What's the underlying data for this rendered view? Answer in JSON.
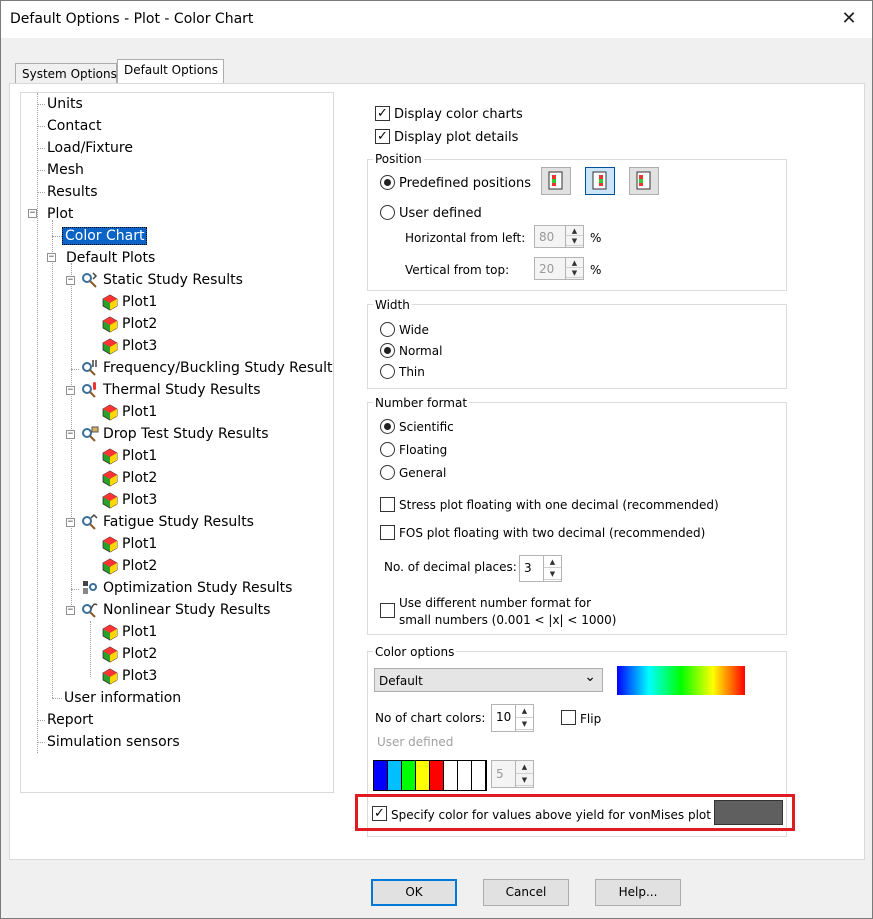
{
  "window": {
    "title": "Default Options - Plot - Color Chart",
    "close": "✕"
  },
  "tabs": [
    {
      "label": "System Options"
    },
    {
      "label": "Default Options"
    }
  ],
  "tree": {
    "units": "Units",
    "contact": "Contact",
    "load": "Load/Fixture",
    "mesh": "Mesh",
    "results": "Results",
    "plot": "Plot",
    "color_chart": "Color Chart",
    "default_plots": "Default Plots",
    "static": "Static Study Results",
    "freq": "Frequency/Buckling Study Results",
    "thermal": "Thermal Study Results",
    "drop": "Drop Test Study Results",
    "fatigue": "Fatigue Study Results",
    "optimization": "Optimization Study Results",
    "nonlinear": "Nonlinear Study Results",
    "plot1": "Plot1",
    "plot2": "Plot2",
    "plot3": "Plot3",
    "user_info": "User information",
    "report": "Report",
    "sensors": "Simulation sensors",
    "expand_sign": "+",
    "collapse_sign": "−"
  },
  "display": {
    "color_charts": "Display color charts",
    "plot_details": "Display plot details",
    "check": "✓"
  },
  "position": {
    "title": "Position",
    "predefined": "Predefined positions",
    "user_defined": "User defined",
    "horizontal_label": "Horizontal from left:",
    "horizontal_value": "80",
    "vertical_label": "Vertical from top:",
    "vertical_value": "20",
    "percent": "%"
  },
  "width": {
    "title": "Width",
    "wide": "Wide",
    "normal": "Normal",
    "thin": "Thin"
  },
  "number_format": {
    "title": "Number format",
    "scientific": "Scientific",
    "floating": "Floating",
    "general": "General",
    "stress_floating": "Stress plot floating with one decimal (recommended)",
    "fos_floating": "FOS plot floating with two decimal (recommended)",
    "decimal_label": "No. of decimal places:",
    "decimal_value": "3",
    "small_numbers_line1": "Use different number format for",
    "small_numbers_line2": "small numbers (0.001 < |x| < 1000)"
  },
  "color_options": {
    "title": "Color options",
    "scheme": "Default",
    "chart_colors_label": "No of chart colors:",
    "chart_colors_value": "10",
    "flip": "Flip",
    "user_defined": "User defined",
    "swatch_count": "5",
    "yield_label": "Specify color for values above yield for vonMises plot",
    "yield_color": "#5f5f5f",
    "swatches": [
      "#0000ff",
      "#00bfff",
      "#00ff00",
      "#ffff00",
      "#ff0000",
      "#ffffff",
      "#ffffff",
      "#ffffff"
    ]
  },
  "spin_arrows": {
    "up": "▲",
    "down": "▼",
    "dropdown": "⌄"
  },
  "buttons": {
    "ok": "OK",
    "cancel": "Cancel",
    "help": "Help..."
  },
  "colors": {
    "highlight": "#e21b23",
    "selection": "#0a64c8",
    "default_button_border": "#0078d7"
  }
}
